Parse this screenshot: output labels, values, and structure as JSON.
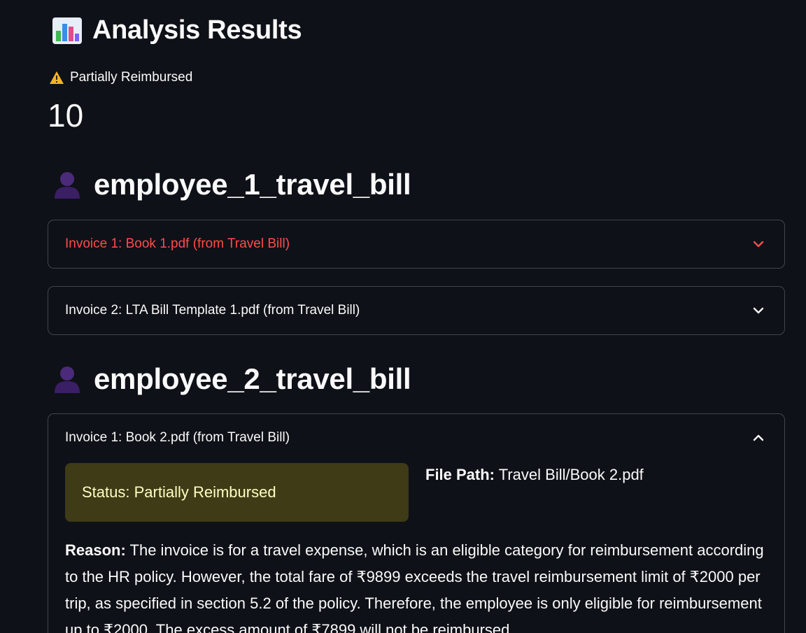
{
  "header": {
    "icon": "bar-chart-icon",
    "title": "Analysis Results"
  },
  "metric": {
    "icon": "warning-icon",
    "label": "Partially Reimbursed",
    "value": "10"
  },
  "employees": [
    {
      "icon": "person-icon",
      "name": "employee_1_travel_bill",
      "invoices": [
        {
          "label": "Invoice 1: Book 1.pdf (from Travel Bill)",
          "expanded": false,
          "active": true
        },
        {
          "label": "Invoice 2: LTA Bill Template 1.pdf (from Travel Bill)",
          "expanded": false,
          "active": false
        }
      ]
    },
    {
      "icon": "person-icon",
      "name": "employee_2_travel_bill",
      "invoices": [
        {
          "label": "Invoice 1: Book 2.pdf (from Travel Bill)",
          "expanded": true,
          "active": false,
          "status": "Status: Partially Reimbursed",
          "file_path_label": "File Path:",
          "file_path": "Travel Bill/Book 2.pdf",
          "reason_label": "Reason:",
          "reason": "The invoice is for a travel expense, which is an eligible category for reimbursement according to the HR policy. However, the total fare of ₹9899 exceeds the travel reimbursement limit of ₹2000 per trip, as specified in section 5.2 of the policy. Therefore, the employee is only eligible for reimbursement up to ₹2000. The excess amount of ₹7899 will not be reimbursed."
        }
      ]
    }
  ],
  "colors": {
    "background": "#0e1117",
    "text": "#fafafa",
    "active_expander": "#ff4b4b",
    "status_bg": "#3e3b16",
    "status_text": "#ffffc2"
  }
}
